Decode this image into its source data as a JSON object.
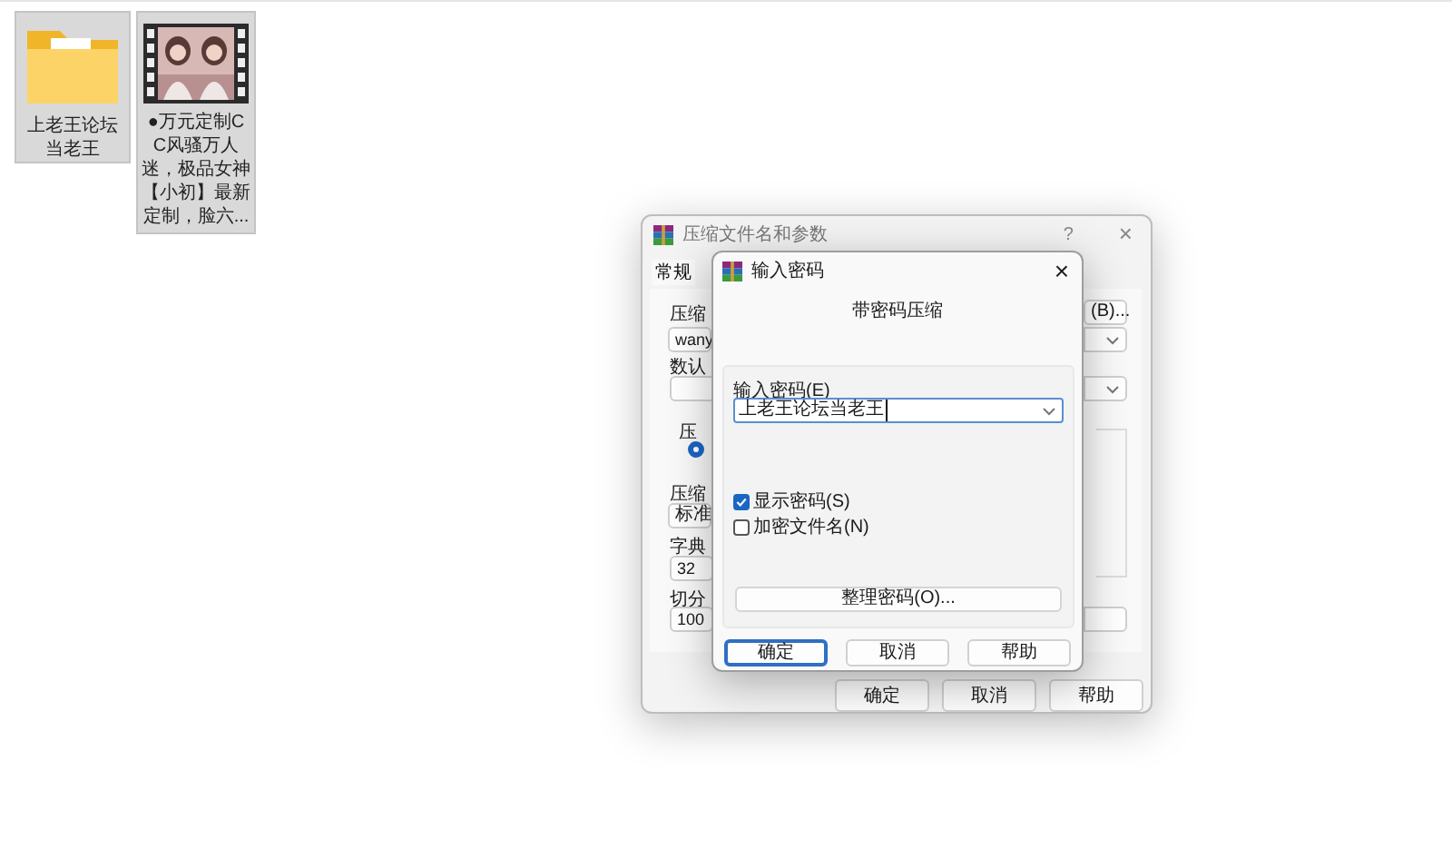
{
  "desktop_icons": [
    {
      "kind": "folder",
      "label": "上老王论坛当老王",
      "selected": true
    },
    {
      "kind": "video",
      "label": "●万元定制CC风骚万人迷，极品女神【小初】最新定制，脸六...",
      "selected": true
    }
  ],
  "back_dialog": {
    "title": "压缩文件名和参数",
    "help": "?",
    "close": "×",
    "tabs": [
      {
        "label": "常规",
        "selected": true
      }
    ],
    "archive_label": "压缩",
    "archive_value": "wany",
    "browse_button": "(B)...",
    "profile_label": "数认",
    "group_label": "压",
    "radio_selected": true,
    "method_label": "压缩",
    "method_value": "标准",
    "dict_label": "字典",
    "dict_value": "32",
    "split_label": "切分",
    "split_value": "100",
    "buttons": [
      "确定",
      "取消",
      "帮助"
    ]
  },
  "password_dialog": {
    "title": "输入密码",
    "close": "×",
    "heading": "带密码压缩",
    "password_label": "输入密码(E)",
    "password_value": "上老王论坛当老王",
    "options": [
      {
        "label": "显示密码(S)",
        "checked": true
      },
      {
        "label": "加密文件名(N)",
        "checked": false
      }
    ],
    "organize_button": "整理密码(O)...",
    "buttons": [
      {
        "label": "确定",
        "default": true
      },
      {
        "label": "取消",
        "default": false
      },
      {
        "label": "帮助",
        "default": false
      }
    ]
  }
}
